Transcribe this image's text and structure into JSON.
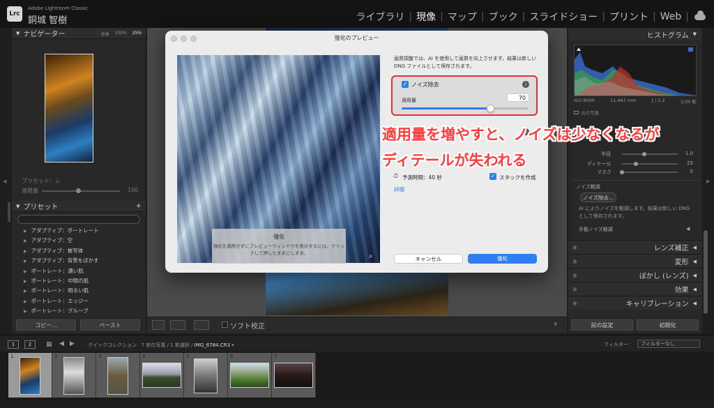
{
  "app": {
    "logo": "Lrc",
    "name": "Adobe Lightroom Classic",
    "user": "銅城 智樹"
  },
  "modules": [
    "ライブラリ",
    "現像",
    "マップ",
    "ブック",
    "スライドショー",
    "プリント",
    "Web"
  ],
  "active_module": "現像",
  "navigator": {
    "title": "ナビゲーター",
    "zoom": [
      "全体",
      "100%",
      "25%"
    ],
    "zoom_selected": "25%"
  },
  "preset_amount": {
    "label_preset": "プリセット：レ",
    "label_amount": "適用量",
    "value": "100"
  },
  "presets": {
    "title": "プリセット",
    "search_placeholder": "",
    "items": [
      "アダプティブ：ポートレート",
      "アダプティブ：空",
      "アダプティブ：被写体",
      "アダプティブ：背景をぼかす",
      "ポートレート：濃い肌",
      "ポートレート：中間の肌",
      "ポートレート：明るい肌",
      "ポートレート：エッジー",
      "ポートレート：グループ"
    ]
  },
  "left_buttons": {
    "copy": "コピー...",
    "paste": "ペースト"
  },
  "toolbar": {
    "soft_proof": "ソフト校正"
  },
  "histogram": {
    "title": "ヒストグラム",
    "iso": "ISO 8000",
    "focal": "11.467 mm",
    "aperture": "ƒ / 2.2",
    "shutter": "1/30 秒",
    "original": "元の写真"
  },
  "detail_sliders": [
    {
      "label": "半径",
      "value": "1.0",
      "pos": 0.4
    },
    {
      "label": "ディテール",
      "value": "25",
      "pos": 0.25
    },
    {
      "label": "マスク",
      "value": "0",
      "pos": 0.0
    }
  ],
  "noise": {
    "title": "ノイズ軽減",
    "button": "ノイズ除去...",
    "desc": "AI によりノイズを軽減します。結果は新しい DNG として保存されます。",
    "manual": "手動ノイズ軽減"
  },
  "right_sections": [
    "レンズ補正",
    "変形",
    "ぼかし (レンズ)",
    "効果",
    "キャリブレーション"
  ],
  "right_buttons": {
    "prev": "前の設定",
    "reset": "初期化"
  },
  "filmbar": {
    "collection": "クイックコレクション",
    "count": "7 枚の写真 / 1 枚選択 /",
    "filename": "IMG_6784.CR3",
    "filter_label": "フィルター：",
    "filter_value": "フィルターなし",
    "pages": [
      "1",
      "2"
    ]
  },
  "filmstrip": [
    "1",
    "2",
    "3",
    "4",
    "5",
    "6",
    "7"
  ],
  "dialog": {
    "title": "強化のプレビュー",
    "description": "画質調整では、AI を使用して画質を向上させます。結果は新しい DNG ファイルとして保存されます。",
    "noise_label": "ノイズ除去",
    "amount_label": "適用量",
    "amount_value": "70",
    "amount": 70,
    "tip_title": "強化",
    "tip_text": "強化を適用せずにプレビューウィンドウを表示するには、クリックして押したままにします。",
    "time_label": "予測時間：40 秒",
    "stack_label": "スタックを作成",
    "details": "詳細",
    "cancel": "キャンセル",
    "enhance": "強化"
  },
  "annotation": {
    "line1": "適用量を増やすと、ノイズは少なくなるが",
    "line2": "ディテールが失われる"
  }
}
